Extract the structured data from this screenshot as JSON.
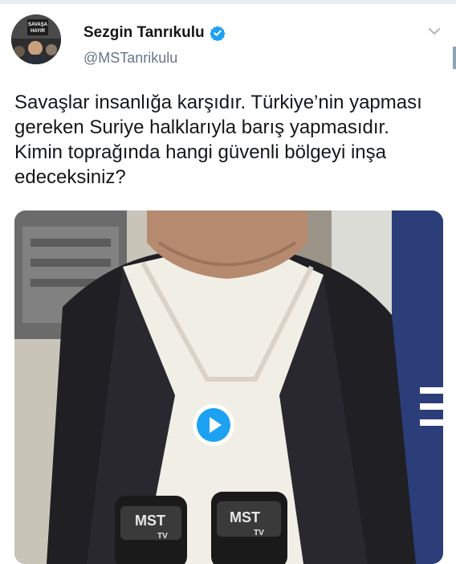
{
  "tweet": {
    "author_name": "Sezgin Tanrıkulu",
    "author_handle": "@MSTanrikulu",
    "text": "Savaşlar insanlığa karşıdır. Türkiye’nin yapması gereken Suriye halklarıyla barış yapmasıdır. Kimin toprağında hangi güvenli bölgeyi inşa edeceksiniz?",
    "avatar_sign_text": "SAVAŞA HAYIR",
    "media": {
      "type": "video",
      "mic_logo_1": "MST",
      "mic_logo_2": "MST",
      "mic_logo_suffix": "TV"
    }
  },
  "icons": {
    "verified": "verified-badge-icon",
    "more": "chevron-down-icon",
    "play": "play-icon"
  },
  "colors": {
    "accent": "#1da1f2",
    "text": "#14171a",
    "muted": "#657786"
  }
}
